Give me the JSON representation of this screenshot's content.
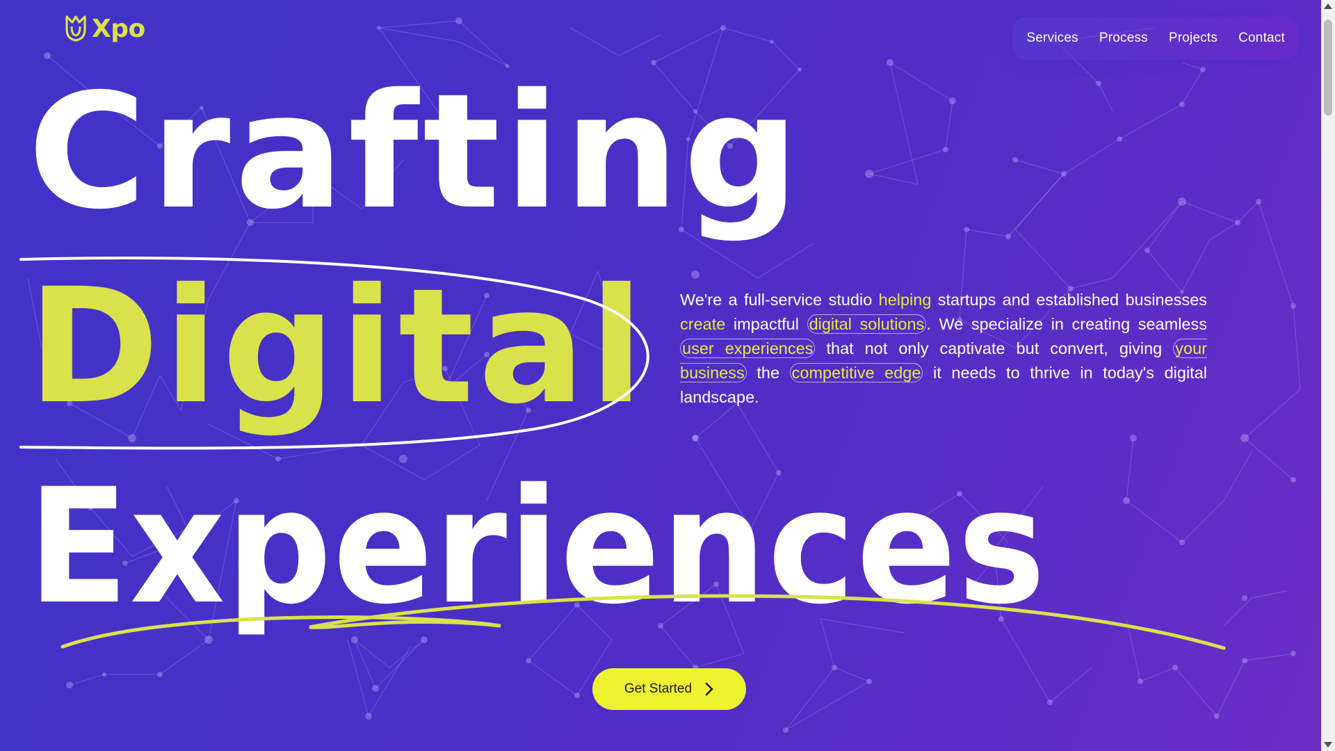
{
  "brand": {
    "name": "Xpo",
    "logo_icon": "tulip-logo-icon"
  },
  "nav": {
    "items": [
      {
        "label": "Services"
      },
      {
        "label": "Process"
      },
      {
        "label": "Projects"
      },
      {
        "label": "Contact"
      }
    ]
  },
  "hero": {
    "line1": "Crafting",
    "line2": "Digital",
    "line3": "Experiences"
  },
  "blurb": {
    "p1": "We're a full-service studio ",
    "h1": "helping",
    "p2": " startups and established businesses ",
    "h2": "create",
    "p3": " impactful ",
    "h3": "digital solutions",
    "p4": ". We specialize in creating seamless ",
    "h4": "user experiences",
    "p5": " that not only captivate but convert, giving ",
    "h5": "your business",
    "p6": " the ",
    "h6": "competitive edge",
    "p7": " it needs to thrive in today's digital landscape."
  },
  "cta": {
    "label": "Get Started",
    "icon": "chevron-right-icon"
  },
  "colors": {
    "accent": "#d9e24a",
    "button": "#eef22f",
    "background_start": "#4233c8",
    "background_end": "#6a2ec6"
  }
}
